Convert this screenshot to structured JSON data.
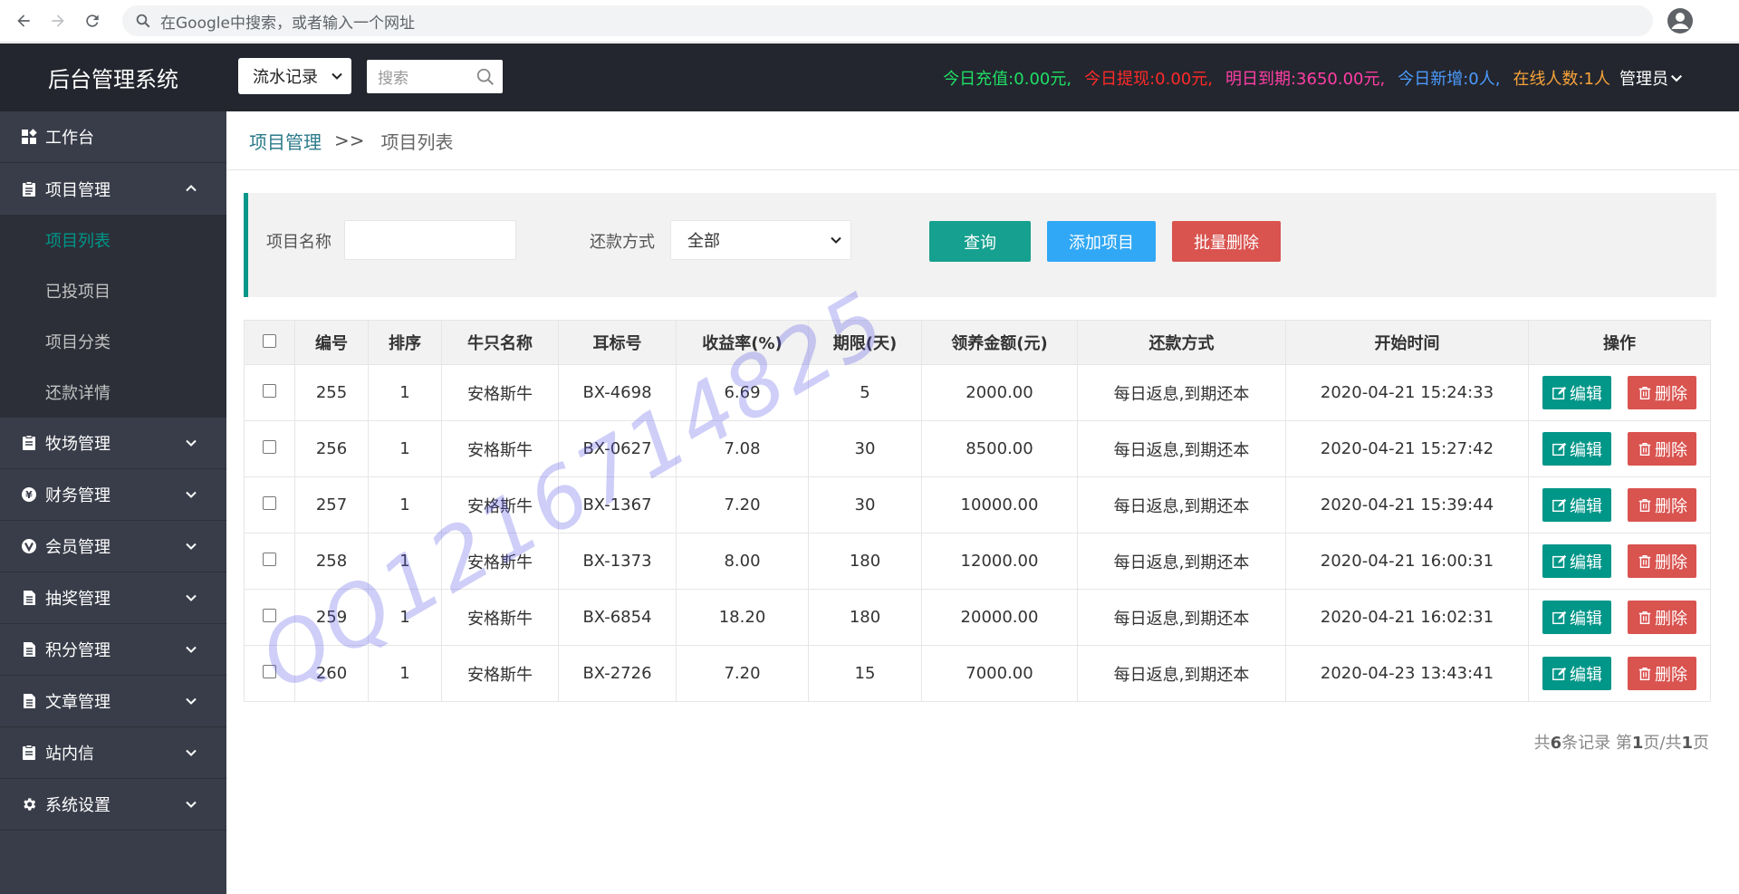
{
  "browser": {
    "omnibox_placeholder": "在Google中搜索，或者输入一个网址"
  },
  "header": {
    "brand": "后台管理系统",
    "flow_select": "流水记录",
    "search_placeholder": "搜索",
    "stats": {
      "recharge_label": "今日充值:",
      "recharge_value": "0.00元,",
      "withdraw_label": "今日提现:",
      "withdraw_value": "0.00元,",
      "due_label": "明日到期:",
      "due_value": "3650.00元,",
      "new_label": "今日新增:",
      "new_value": "0人,",
      "online_label": "在线人数:",
      "online_value": "1人"
    },
    "admin_label": "管理员"
  },
  "sidebar": {
    "items": [
      {
        "label": "工作台"
      },
      {
        "label": "项目管理",
        "sub": [
          "项目列表",
          "已投项目",
          "项目分类",
          "还款详情"
        ]
      },
      {
        "label": "牧场管理"
      },
      {
        "label": "财务管理"
      },
      {
        "label": "会员管理"
      },
      {
        "label": "抽奖管理"
      },
      {
        "label": "积分管理"
      },
      {
        "label": "文章管理"
      },
      {
        "label": "站内信"
      },
      {
        "label": "系统设置"
      }
    ]
  },
  "breadcrumb": {
    "parent": "项目管理",
    "separator": ">>",
    "current": "项目列表"
  },
  "filter": {
    "name_label": "项目名称",
    "name_value": "",
    "repay_label": "还款方式",
    "repay_value": "全部",
    "query_btn": "查询",
    "add_btn": "添加项目",
    "batch_delete_btn": "批量删除"
  },
  "table": {
    "headers": [
      "编号",
      "排序",
      "牛只名称",
      "耳标号",
      "收益率(%)",
      "期限(天)",
      "领养金额(元)",
      "还款方式",
      "开始时间",
      "操作"
    ],
    "rows": [
      {
        "id": "255",
        "sort": "1",
        "name": "安格斯牛",
        "tag": "BX-4698",
        "rate": "6.69",
        "days": "5",
        "amount": "2000.00",
        "repay": "每日返息,到期还本",
        "start": "2020-04-21 15:24:33"
      },
      {
        "id": "256",
        "sort": "1",
        "name": "安格斯牛",
        "tag": "BX-0627",
        "rate": "7.08",
        "days": "30",
        "amount": "8500.00",
        "repay": "每日返息,到期还本",
        "start": "2020-04-21 15:27:42"
      },
      {
        "id": "257",
        "sort": "1",
        "name": "安格斯牛",
        "tag": "BX-1367",
        "rate": "7.20",
        "days": "30",
        "amount": "10000.00",
        "repay": "每日返息,到期还本",
        "start": "2020-04-21 15:39:44"
      },
      {
        "id": "258",
        "sort": "1",
        "name": "安格斯牛",
        "tag": "BX-1373",
        "rate": "8.00",
        "days": "180",
        "amount": "12000.00",
        "repay": "每日返息,到期还本",
        "start": "2020-04-21 16:00:31"
      },
      {
        "id": "259",
        "sort": "1",
        "name": "安格斯牛",
        "tag": "BX-6854",
        "rate": "18.20",
        "days": "180",
        "amount": "20000.00",
        "repay": "每日返息,到期还本",
        "start": "2020-04-21 16:02:31"
      },
      {
        "id": "260",
        "sort": "1",
        "name": "安格斯牛",
        "tag": "BX-2726",
        "rate": "7.20",
        "days": "15",
        "amount": "7000.00",
        "repay": "每日返息,到期还本",
        "start": "2020-04-23 13:43:41"
      }
    ],
    "edit_label": "编辑",
    "delete_label": "删除"
  },
  "pagination": {
    "prefix": "共",
    "total": "6",
    "mid1": "条记录 第",
    "page": "1",
    "mid2": "页/共",
    "pages": "1",
    "suffix": "页"
  },
  "watermark": "QQ1216714825",
  "colors": {
    "accent": "#009688",
    "header_bg": "#23262e",
    "sidebar_bg": "#393d49",
    "danger": "#d9534f",
    "info": "#31a8f5"
  }
}
